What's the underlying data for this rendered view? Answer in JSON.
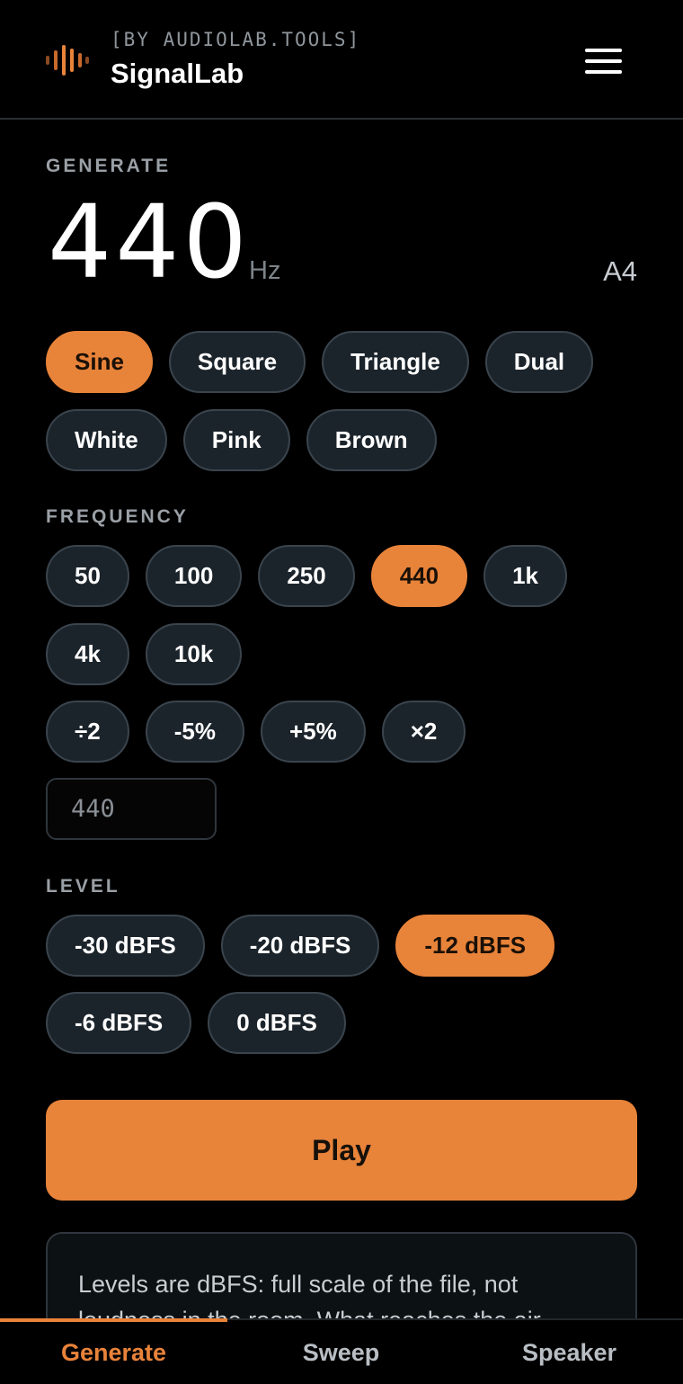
{
  "header": {
    "subtitle": "[BY AUDIOLAB.TOOLS]",
    "title": "SignalLab",
    "menu_icon": "hamburger-menu-icon",
    "logo_icon": "waveform-logo-icon"
  },
  "generate": {
    "label": "GENERATE",
    "frequency_value": "440",
    "unit": "Hz",
    "note": "A4",
    "waveforms": [
      "Sine",
      "Square",
      "Triangle",
      "Dual"
    ],
    "noises": [
      "White",
      "Pink",
      "Brown"
    ],
    "selected_waveform": "Sine"
  },
  "frequency": {
    "label": "FREQUENCY",
    "presets_row1": [
      "50",
      "100",
      "250",
      "440",
      "1k"
    ],
    "presets_row2": [
      "4k",
      "10k"
    ],
    "adjust": [
      "÷2",
      "-5%",
      "+5%",
      "×2"
    ],
    "selected": "440",
    "input_placeholder": "440"
  },
  "level": {
    "label": "LEVEL",
    "row1": [
      "-30 dBFS",
      "-20 dBFS",
      "-12 dBFS"
    ],
    "row2": [
      "-6 dBFS",
      "0 dBFS"
    ],
    "selected": "-12 dBFS"
  },
  "play_label": "Play",
  "info_text": "Levels are dBFS: full scale of the file, not loudness in the room. What reaches the air",
  "tabs": [
    "Generate",
    "Sweep",
    "Speaker"
  ],
  "active_tab": "Generate",
  "colors": {
    "accent": "#e8833a",
    "chip_bg": "#1c242b",
    "background": "#000000"
  }
}
